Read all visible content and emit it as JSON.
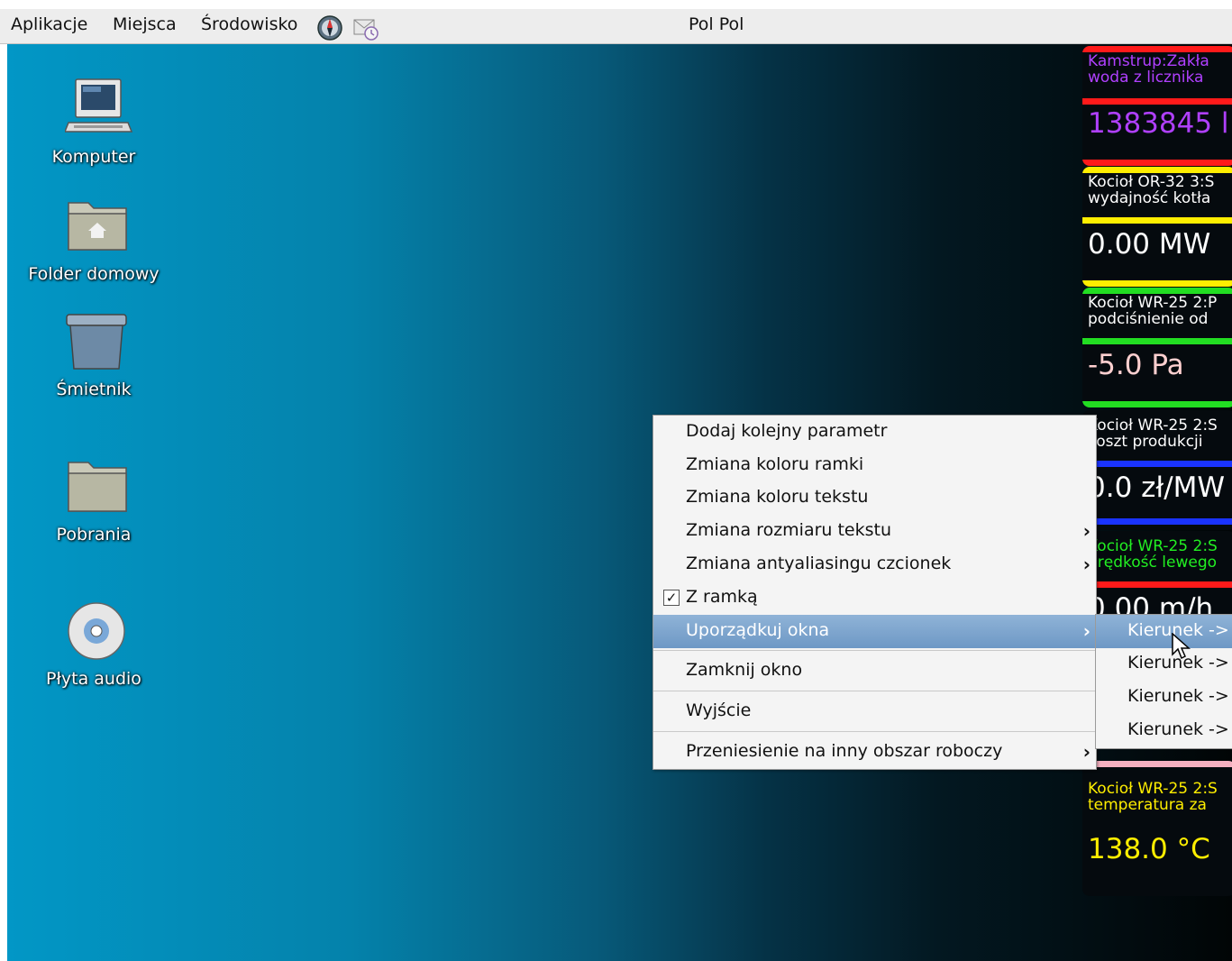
{
  "topbar": {
    "menus": [
      "Aplikacje",
      "Miejsca",
      "Środowisko"
    ],
    "user": "Pol Pol",
    "icons": [
      "compass-icon",
      "mail-icon"
    ]
  },
  "desktop_icons": [
    {
      "label": "Komputer",
      "icon": "computer-icon"
    },
    {
      "label": "Folder domowy",
      "icon": "home-folder-icon"
    },
    {
      "label": "Śmietnik",
      "icon": "trash-icon"
    },
    {
      "label": "Pobrania",
      "icon": "folder-icon"
    },
    {
      "label": "Płyta audio",
      "icon": "cd-icon"
    }
  ],
  "widgets": [
    {
      "line1": "Kamstrup:Zakła",
      "line2": "woda z licznika",
      "value": "1383845 l",
      "color": "#ff1a1a",
      "text_color": "#b040ff"
    },
    {
      "line1": "Kocioł OR-32 3:S",
      "line2": "wydajność kotła",
      "value": "0.00 MW",
      "color": "#ffee00",
      "text_color": "#ffffff"
    },
    {
      "line1": "Kocioł WR-25 2:P",
      "line2": "podciśnienie od",
      "value": "-5.0 Pa",
      "color": "#22dd22",
      "text_color": "#ffffff",
      "value_color": "#ffd0d0"
    },
    {
      "line1": "Kocioł WR-25 2:S",
      "line2": "koszt produkcji",
      "value": "0.0 zł/MW",
      "color": "#1a33ff",
      "text_color": "#ffffff"
    },
    {
      "line1": "Kocioł WR-25 2:S",
      "line2": "prędkość lewego",
      "value": "0.00 m/h",
      "color": "#ff1a1a",
      "text_color": "#22ee22"
    },
    {
      "line1": "Kocioł WR-25 2:S",
      "line2": "temperatura za",
      "value": "138.0 °C",
      "color": "#f5b0c0",
      "text_color": "#ffee00"
    }
  ],
  "context_menu": {
    "items": [
      {
        "label": "Dodaj kolejny parametr"
      },
      {
        "label": "Zmiana koloru ramki"
      },
      {
        "label": "Zmiana koloru tekstu"
      },
      {
        "label": "Zmiana rozmiaru tekstu",
        "submenu": true
      },
      {
        "label": "Zmiana antyaliasingu czcionek",
        "submenu": true
      },
      {
        "label": "Z ramką",
        "checked": true
      },
      {
        "label": "Uporządkuj okna",
        "submenu": true,
        "highlighted": true
      },
      {
        "label": "Zamknij okno"
      },
      {
        "label": "Wyjście"
      },
      {
        "label": "Przeniesienie na inny obszar roboczy",
        "submenu": true
      }
    ],
    "arrow": "›",
    "check": "✓"
  },
  "submenu": {
    "items": [
      "Kierunek ->",
      "Kierunek ->",
      "Kierunek ->",
      "Kierunek ->"
    ]
  }
}
